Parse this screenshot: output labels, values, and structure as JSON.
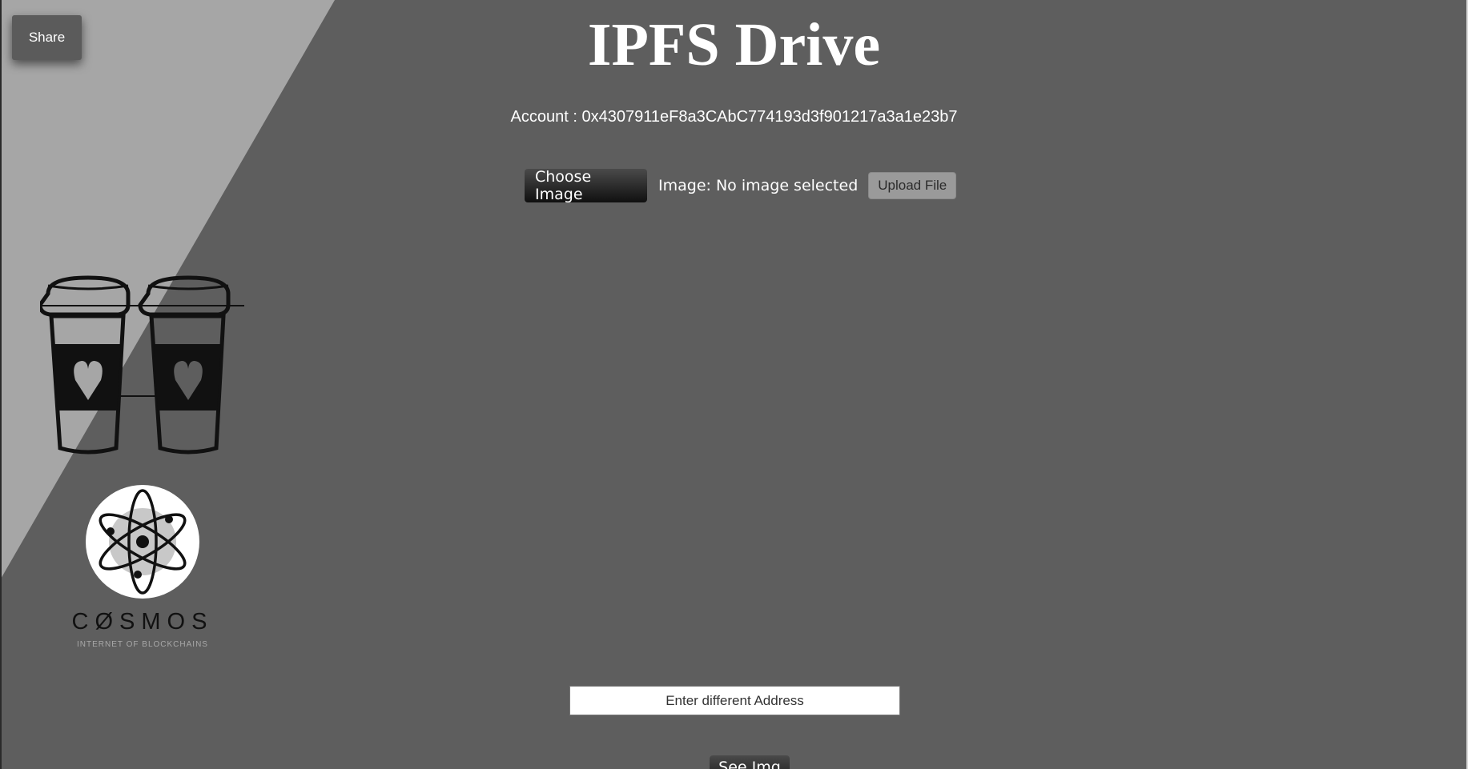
{
  "share": {
    "label": "Share"
  },
  "header": {
    "title": "IPFS Drive"
  },
  "account": {
    "label": "Account :",
    "address": "0x4307911eF8a3CAbC774193d3f901217a3a1e23b7"
  },
  "upload": {
    "choose_label": "Choose Image",
    "status_prefix": "Image:",
    "status_value": "No image selected",
    "upload_label": "Upload File"
  },
  "sponsors": {
    "cups_icon": "two-coffee-cups-with-hearts-icon",
    "cosmos_icon": "cosmos-atom-icon",
    "cosmos_name": "CØSMOS",
    "cosmos_tagline": "INTERNET OF BLOCKCHAINS"
  },
  "address_lookup": {
    "placeholder": "Enter different Address",
    "value": "",
    "see_label": "See Img"
  },
  "colors": {
    "background": "#5e5e5e",
    "triangle": "#a6a6a6",
    "button_dark": "#1a1a1a",
    "upload_button": "#9a9a9a"
  }
}
